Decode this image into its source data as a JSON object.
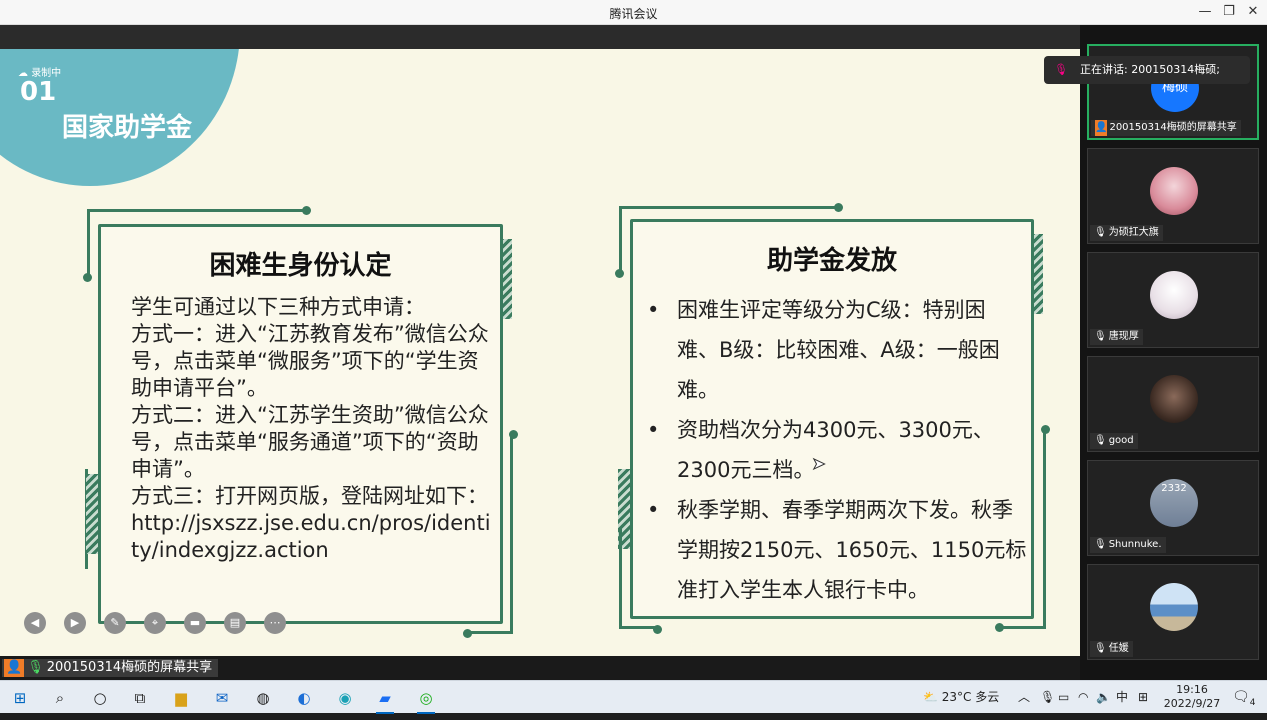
{
  "window": {
    "title": "腾讯会议",
    "min": "—",
    "restore": "❐",
    "close": "✕"
  },
  "slide": {
    "recording": "录制中",
    "section_number": "01",
    "section_title": "国家助学金",
    "card1": {
      "title": "困难生身份认定",
      "body": "学生可通过以下三种方式申请：\n方式一：进入“江苏教育发布”微信公众号，点击菜单“微服务”项下的“学生资助申请平台”。\n方式二：进入“江苏学生资助”微信公众号，点击菜单“服务通道”项下的“资助申请”。\n方式三：打开网页版，登陆网址如下：\nhttp://jsxszz.jse.edu.cn/pros/identity/indexgjzz.action"
    },
    "card2": {
      "title": "助学金发放",
      "bullets": [
        "困难生评定等级分为C级：特别困难、B级：比较困难、A级：一般困难。",
        "资助档次分为4300元、3300元、2300元三档。",
        "秋季学期、春季学期两次下发。秋季学期按2150元、1650元、1150元标准打入学生本人银行卡中。"
      ]
    }
  },
  "share_label": "200150314梅硕的屏幕共享",
  "speaking": "正在讲话: 200150314梅硕;",
  "participants": [
    {
      "name": "200150314梅硕的屏幕共享",
      "avatar_text": "梅硕",
      "color": "#1677ff"
    },
    {
      "name": "为硕扛大旗",
      "avatar_text": "",
      "color": "#d98b9a"
    },
    {
      "name": "唐现厚",
      "avatar_text": "",
      "color": "#e8dfe6"
    },
    {
      "name": "good",
      "avatar_text": "",
      "color": "#3b2a22"
    },
    {
      "name": "Shunnuke.",
      "avatar_text": "2332",
      "color": "#6f7f96"
    },
    {
      "name": "任媛",
      "avatar_text": "",
      "color": "#5c8fc7"
    }
  ],
  "taskbar": {
    "weather": "23°C 多云",
    "ime": "中",
    "time": "19:16",
    "date": "2022/9/27",
    "notifications": "4"
  }
}
